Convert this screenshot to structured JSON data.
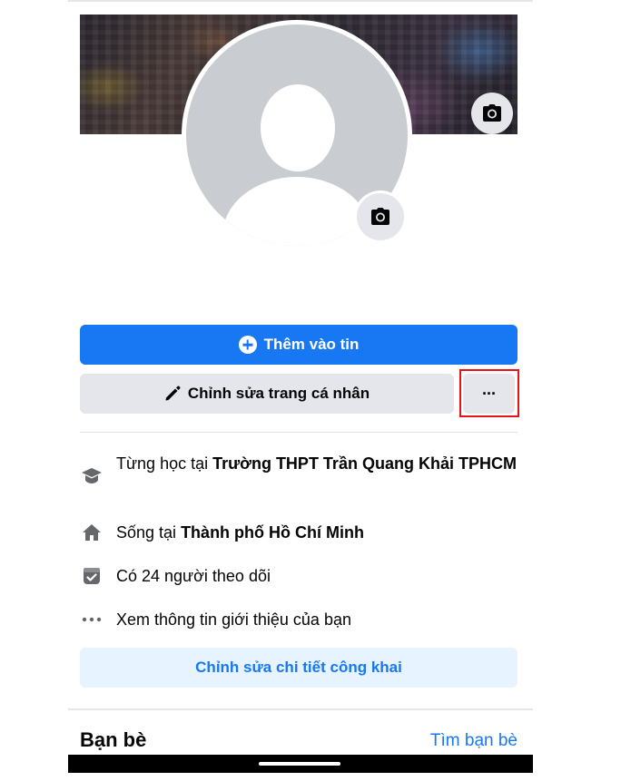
{
  "profile": {
    "add_story_label": "Thêm vào tin",
    "edit_profile_label": "Chỉnh sửa trang cá nhân",
    "more_label": "···"
  },
  "info": {
    "education_prefix": "Từng học tại ",
    "education_place": "Trường THPT Trần Quang Khải TPHCM",
    "lives_prefix": "Sống tại ",
    "lives_place": "Thành phố Hồ Chí Minh",
    "followers": "Có 24 người theo dõi",
    "see_about": "Xem thông tin giới thiệu của bạn",
    "edit_public_details": "Chỉnh sửa chi tiết công khai"
  },
  "friends": {
    "title": "Bạn bè",
    "find_label": "Tìm bạn bè"
  },
  "colors": {
    "primary": "#1877f2",
    "secondary_bg": "#e4e6eb",
    "light_blue_bg": "#e7f3ff",
    "highlight": "#e4141a"
  },
  "icons": {
    "cover_camera": "camera-icon",
    "avatar_camera": "camera-icon",
    "add_story": "plus-circle-icon",
    "edit": "pencil-icon",
    "education": "graduation-cap-icon",
    "home": "home-icon",
    "followers": "followers-icon",
    "more": "more-dots-icon"
  }
}
